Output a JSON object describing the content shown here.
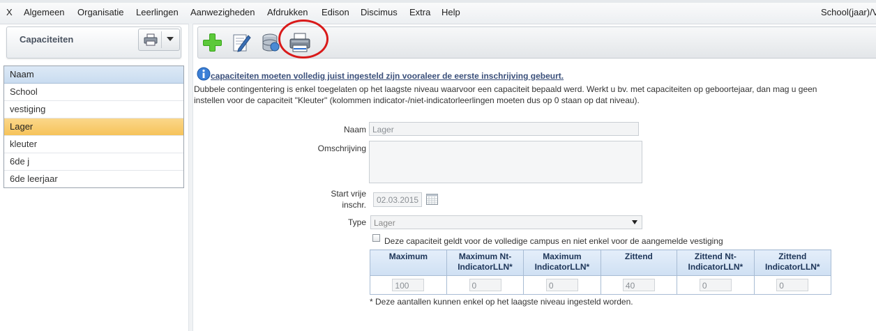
{
  "menubar": {
    "items": [
      "X",
      "Algemeen",
      "Organisatie",
      "Leerlingen",
      "Aanwezigheden",
      "Afdrukken",
      "Edison",
      "Discimus",
      "Extra",
      "Help"
    ],
    "right_text": "School(jaar)/V"
  },
  "left_panel": {
    "title": "Capaciteiten",
    "list_header": "Naam",
    "rows": [
      "School",
      "vestiging",
      "Lager",
      "kleuter",
      "6de j",
      "6de leerjaar"
    ],
    "selected_index": 2
  },
  "toolbar": {
    "buttons": [
      "add-icon",
      "edit-icon",
      "database-icon",
      "printer-icon"
    ]
  },
  "info": {
    "title": "capaciteiten moeten volledig juist ingesteld zijn vooraleer de eerste inschrijving gebeurt.",
    "line1": "Dubbele contingentering is enkel toegelaten op het laagste niveau waarvoor een capaciteit bepaald werd. Werkt u bv. met capaciteiten op geboortejaar, dan mag u geen",
    "line2": "instellen voor de capaciteit \"Kleuter\" (kolommen indicator-/niet-indicatorleerlingen moeten dus op 0 staan op dat niveau)."
  },
  "form": {
    "naam_label": "Naam",
    "naam_value": "Lager",
    "omschrijving_label": "Omschrijving",
    "omschrijving_value": "",
    "start_label_1": "Start vrije",
    "start_label_2": "inschr.",
    "start_value": "02.03.2015",
    "type_label": "Type",
    "type_value": "Lager",
    "checkbox_label": "Deze capaciteit geldt voor de volledige campus en niet enkel voor de aangemelde vestiging",
    "checkbox_checked": false
  },
  "capacity_table": {
    "headers": [
      [
        "Maximum",
        ""
      ],
      [
        "Maximum Nt-",
        "IndicatorLLN*"
      ],
      [
        "Maximum",
        "IndicatorLLN*"
      ],
      [
        "Zittend",
        ""
      ],
      [
        "Zittend Nt-",
        "IndicatorLLN*"
      ],
      [
        "Zittend",
        "IndicatorLLN*"
      ]
    ],
    "values": [
      "100",
      "0",
      "0",
      "40",
      "0",
      "0"
    ]
  },
  "footnote": "*  Deze aantallen kunnen enkel op het laagste niveau ingesteld worden."
}
